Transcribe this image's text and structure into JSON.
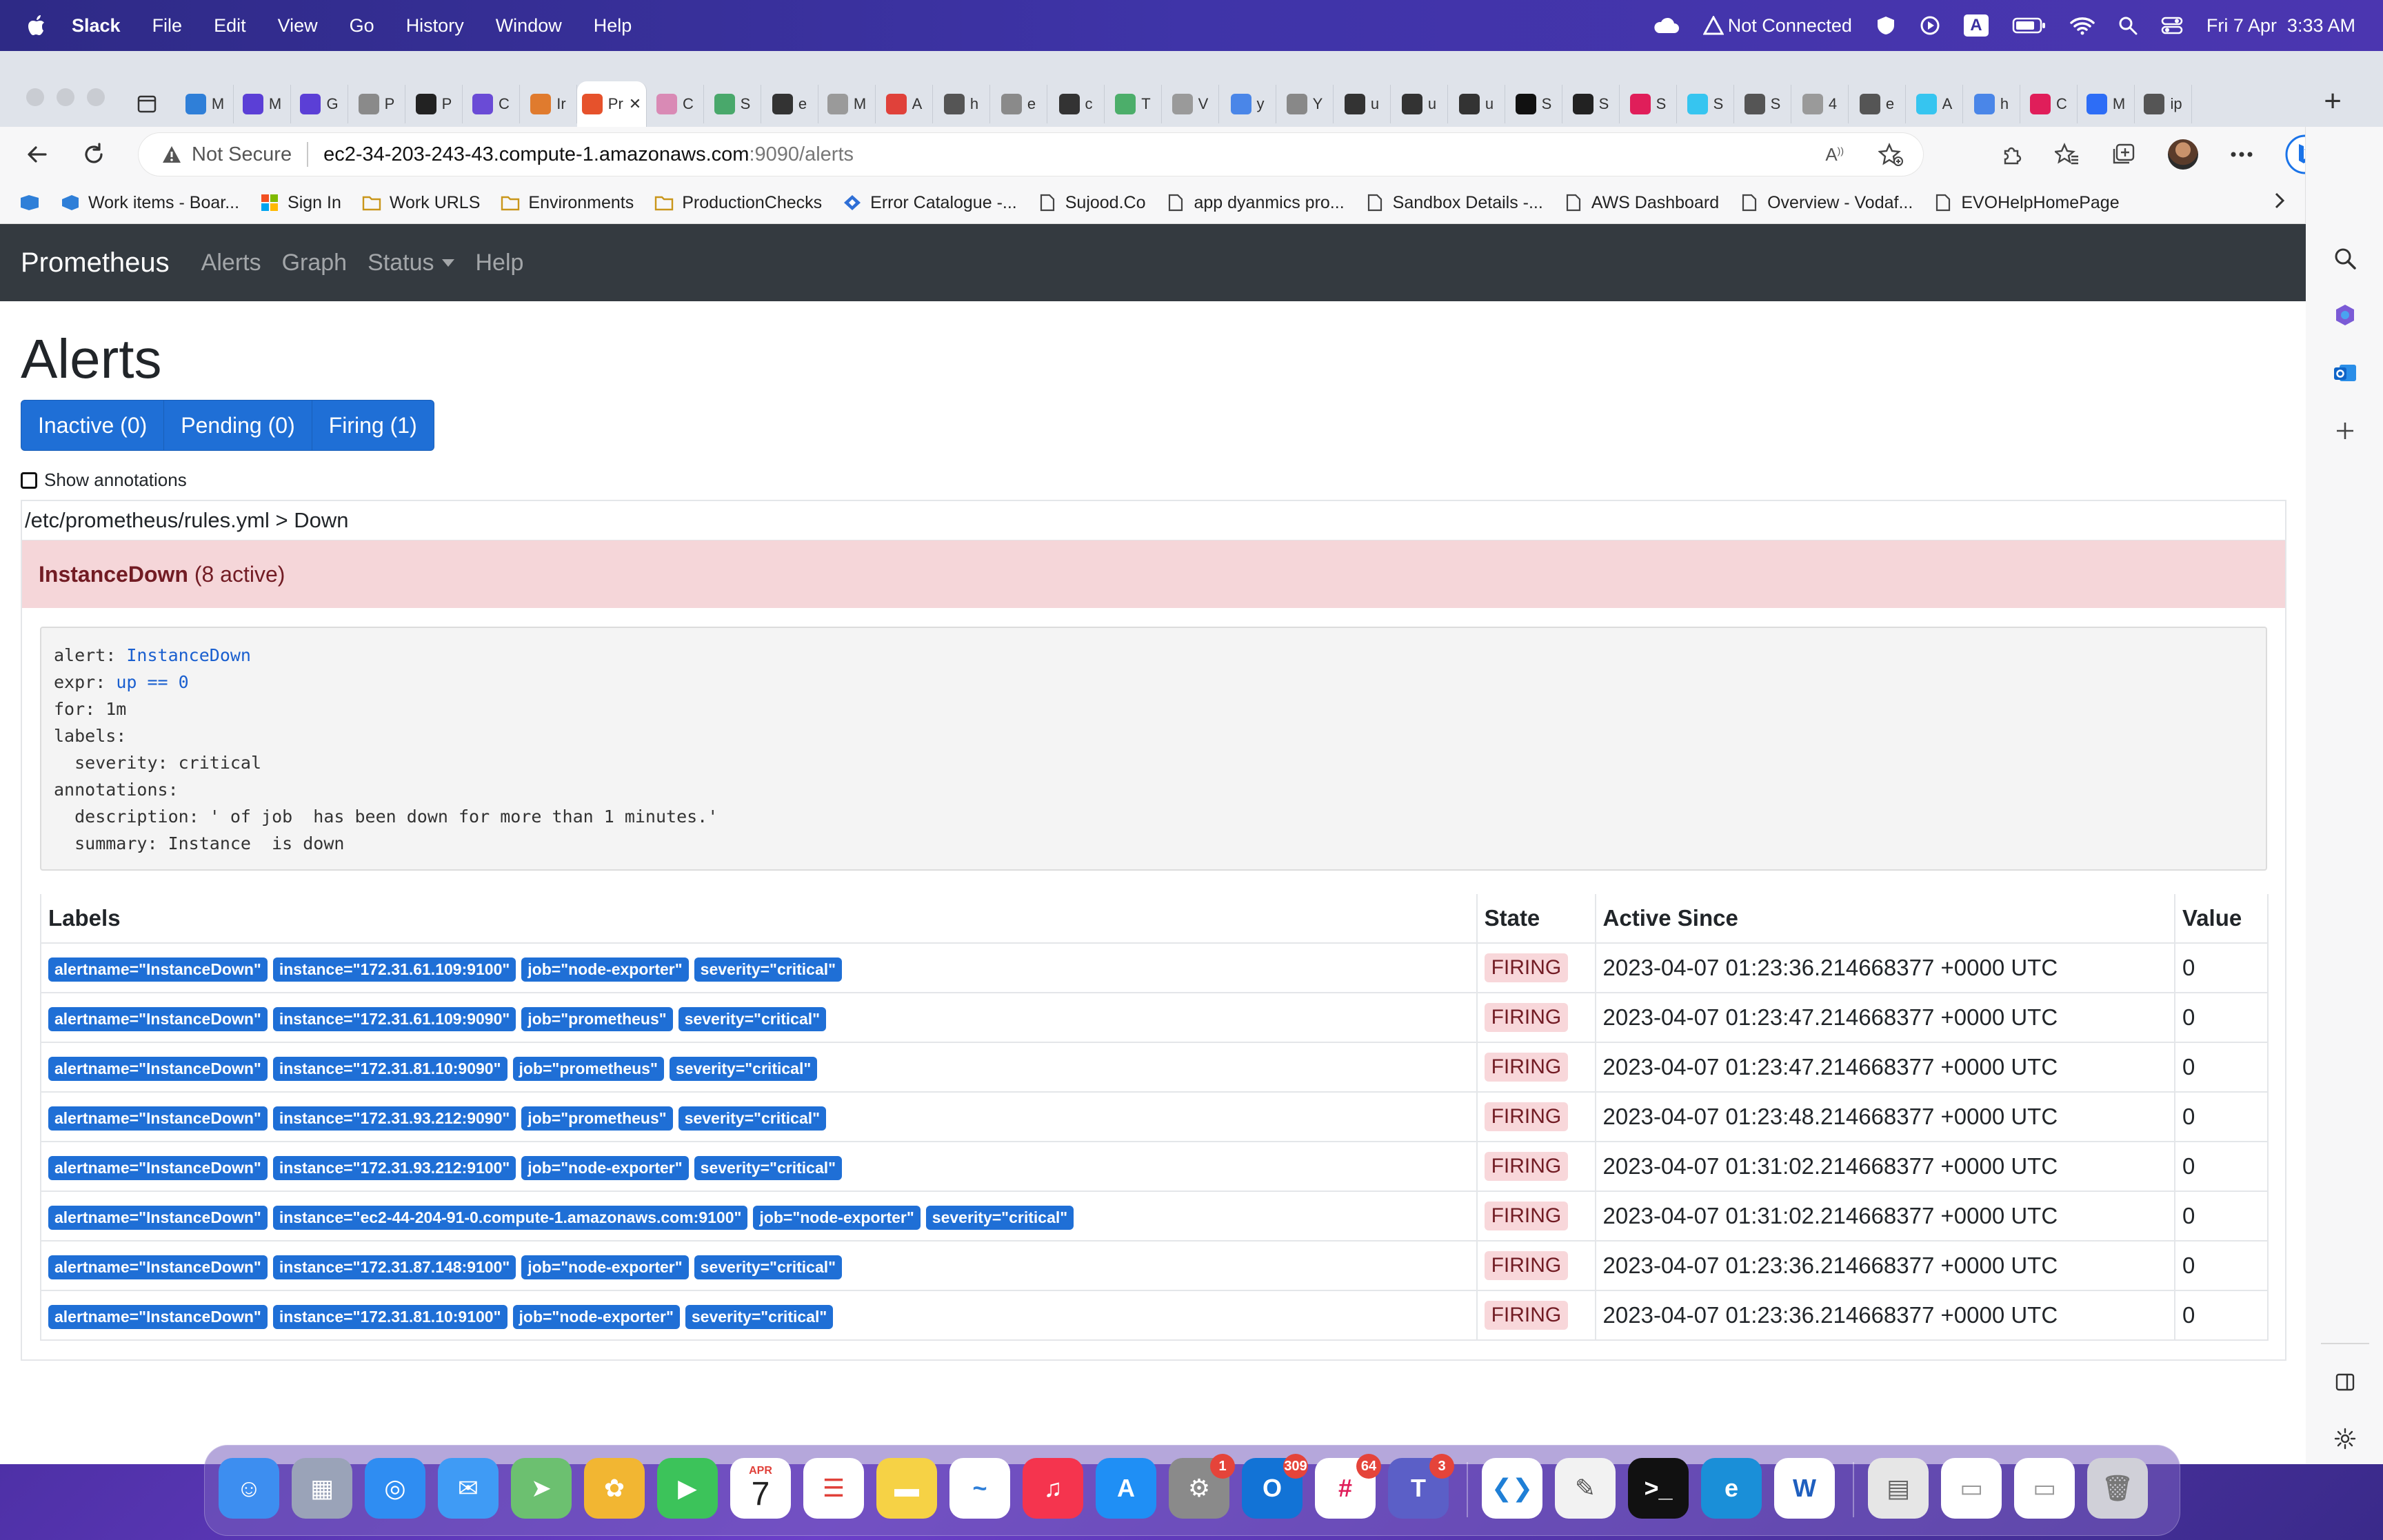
{
  "menubar": {
    "app": "Slack",
    "items": [
      "File",
      "Edit",
      "View",
      "Go",
      "History",
      "Window",
      "Help"
    ],
    "network_status": "Not Connected",
    "datetime": "Fri 7 Apr  3:33 AM",
    "input_source": "A"
  },
  "browser": {
    "tabs": [
      {
        "label": "M",
        "color": "#2f7fd8"
      },
      {
        "label": "M",
        "color": "#5b3fd6"
      },
      {
        "label": "G",
        "color": "#5b3fd6"
      },
      {
        "label": "P",
        "color": "#8a8a8a"
      },
      {
        "label": "P",
        "color": "#222222"
      },
      {
        "label": "C",
        "color": "#6a4bd6"
      },
      {
        "label": "Ir",
        "color": "#e07b2e"
      },
      {
        "label": "Pr",
        "color": "#e6522c",
        "active": true
      },
      {
        "label": "C",
        "color": "#d98ab5"
      },
      {
        "label": "S",
        "color": "#49a86b"
      },
      {
        "label": "e",
        "color": "#333333"
      },
      {
        "label": "M",
        "color": "#9a9a9a"
      },
      {
        "label": "A",
        "color": "#e0413a"
      },
      {
        "label": "h",
        "color": "#555555"
      },
      {
        "label": "e",
        "color": "#8a8a8a"
      },
      {
        "label": "c",
        "color": "#333333"
      },
      {
        "label": "T",
        "color": "#4cae6a"
      },
      {
        "label": "V",
        "color": "#9a9a9a"
      },
      {
        "label": "y",
        "color": "#4a86e8"
      },
      {
        "label": "Y",
        "color": "#888888"
      },
      {
        "label": "u",
        "color": "#333333"
      },
      {
        "label": "u",
        "color": "#333333"
      },
      {
        "label": "u",
        "color": "#333333"
      },
      {
        "label": "S",
        "color": "#111111"
      },
      {
        "label": "S",
        "color": "#222222"
      },
      {
        "label": "S",
        "color": "#e01e5a"
      },
      {
        "label": "S",
        "color": "#36c5f0"
      },
      {
        "label": "S",
        "color": "#555555"
      },
      {
        "label": "4",
        "color": "#9a9a9a"
      },
      {
        "label": "e",
        "color": "#555555"
      },
      {
        "label": "A",
        "color": "#36c5f0"
      },
      {
        "label": "h",
        "color": "#4a86e8"
      },
      {
        "label": "C",
        "color": "#e01e5a"
      },
      {
        "label": "M",
        "color": "#2d6df6"
      },
      {
        "label": "ip",
        "color": "#555555"
      }
    ],
    "new_tab_symbol": "+",
    "address": {
      "security_label": "Not Secure",
      "host": "ec2-34-203-243-43.compute-1.amazonaws.com",
      "path": ":9090/alerts"
    },
    "bookmarks": [
      "Work items - Boar...",
      "Sign In",
      "Work URLS",
      "Environments",
      "ProductionChecks",
      "Error Catalogue -...",
      "Sujood.Co",
      "app dyanmics pro...",
      "Sandbox Details -...",
      "AWS Dashboard",
      "Overview - Vodaf...",
      "EVOHelpHomePage"
    ]
  },
  "prometheus": {
    "brand": "Prometheus",
    "nav": [
      "Alerts",
      "Graph",
      "Status",
      "Help"
    ],
    "page_title": "Alerts",
    "filters": [
      "Inactive (0)",
      "Pending (0)",
      "Firing (1)"
    ],
    "show_annotations": "Show annotations",
    "group_header": "/etc/prometheus/rules.yml > Down",
    "rule_name": "InstanceDown",
    "rule_count": "(8 active)",
    "rule_def": {
      "l1_key": "alert: ",
      "l1_val": "InstanceDown",
      "l2_key": "expr: ",
      "l2_val": "up == 0",
      "l3": "for: 1m",
      "l4": "labels:",
      "l5": "  severity: critical",
      "l6": "annotations:",
      "l7": "  description: ' of job  has been down for more than 1 minutes.'",
      "l8": "  summary: Instance  is down"
    },
    "table_headers": [
      "Labels",
      "State",
      "Active Since",
      "Value"
    ],
    "rows": [
      {
        "labels": [
          "alertname=\"InstanceDown\"",
          "instance=\"172.31.61.109:9100\"",
          "job=\"node-exporter\"",
          "severity=\"critical\""
        ],
        "state": "FIRING",
        "since": "2023-04-07 01:23:36.214668377 +0000 UTC",
        "value": "0"
      },
      {
        "labels": [
          "alertname=\"InstanceDown\"",
          "instance=\"172.31.61.109:9090\"",
          "job=\"prometheus\"",
          "severity=\"critical\""
        ],
        "state": "FIRING",
        "since": "2023-04-07 01:23:47.214668377 +0000 UTC",
        "value": "0"
      },
      {
        "labels": [
          "alertname=\"InstanceDown\"",
          "instance=\"172.31.81.10:9090\"",
          "job=\"prometheus\"",
          "severity=\"critical\""
        ],
        "state": "FIRING",
        "since": "2023-04-07 01:23:47.214668377 +0000 UTC",
        "value": "0"
      },
      {
        "labels": [
          "alertname=\"InstanceDown\"",
          "instance=\"172.31.93.212:9090\"",
          "job=\"prometheus\"",
          "severity=\"critical\""
        ],
        "state": "FIRING",
        "since": "2023-04-07 01:23:48.214668377 +0000 UTC",
        "value": "0"
      },
      {
        "labels": [
          "alertname=\"InstanceDown\"",
          "instance=\"172.31.93.212:9100\"",
          "job=\"node-exporter\"",
          "severity=\"critical\""
        ],
        "state": "FIRING",
        "since": "2023-04-07 01:31:02.214668377 +0000 UTC",
        "value": "0"
      },
      {
        "labels": [
          "alertname=\"InstanceDown\"",
          "instance=\"ec2-44-204-91-0.compute-1.amazonaws.com:9100\"",
          "job=\"node-exporter\"",
          "severity=\"critical\""
        ],
        "state": "FIRING",
        "since": "2023-04-07 01:31:02.214668377 +0000 UTC",
        "value": "0"
      },
      {
        "labels": [
          "alertname=\"InstanceDown\"",
          "instance=\"172.31.87.148:9100\"",
          "job=\"node-exporter\"",
          "severity=\"critical\""
        ],
        "state": "FIRING",
        "since": "2023-04-07 01:23:36.214668377 +0000 UTC",
        "value": "0"
      },
      {
        "labels": [
          "alertname=\"InstanceDown\"",
          "instance=\"172.31.81.10:9100\"",
          "job=\"node-exporter\"",
          "severity=\"critical\""
        ],
        "state": "FIRING",
        "since": "2023-04-07 01:23:36.214668377 +0000 UTC",
        "value": "0"
      }
    ]
  },
  "dock": {
    "apps": [
      {
        "name": "finder-icon",
        "bg": "#3d8ef0",
        "glyph": "☺"
      },
      {
        "name": "launchpad-icon",
        "bg": "#9aa3b8",
        "glyph": "▦"
      },
      {
        "name": "safari-icon",
        "bg": "#2f8df2",
        "glyph": "◎"
      },
      {
        "name": "mail-icon",
        "bg": "#3f9bf5",
        "glyph": "✉"
      },
      {
        "name": "maps-icon",
        "bg": "#6cc070",
        "glyph": "➤"
      },
      {
        "name": "photos-icon",
        "bg": "#f2b632",
        "glyph": "✿"
      },
      {
        "name": "facetime-icon",
        "bg": "#3cc35a",
        "glyph": "▶"
      },
      {
        "name": "calendar-icon",
        "bg": "#ffffff",
        "glyph": "7",
        "fg": "#222222",
        "sub": "APR"
      },
      {
        "name": "reminders-icon",
        "bg": "#ffffff",
        "glyph": "☰",
        "fg": "#e0413a"
      },
      {
        "name": "notes-icon",
        "bg": "#f6d245",
        "glyph": "▬",
        "fg": "#ffffff"
      },
      {
        "name": "freeform-icon",
        "bg": "#ffffff",
        "glyph": "~",
        "fg": "#2f7fd8"
      },
      {
        "name": "music-icon",
        "bg": "#f5344e",
        "glyph": "♫"
      },
      {
        "name": "appstore-icon",
        "bg": "#1f8ff5",
        "glyph": "A"
      },
      {
        "name": "settings-icon",
        "bg": "#8a8a8a",
        "glyph": "⚙",
        "badge": "1"
      },
      {
        "name": "outlook-icon",
        "bg": "#1273d6",
        "glyph": "O",
        "badge": "309"
      },
      {
        "name": "slack-icon",
        "bg": "#ffffff",
        "glyph": "#",
        "fg": "#e01e5a",
        "badge": "64"
      },
      {
        "name": "teams-icon",
        "bg": "#5b5fc7",
        "glyph": "T",
        "badge": "3"
      },
      {
        "name": "vscode-icon",
        "bg": "#ffffff",
        "glyph": "❮❯",
        "fg": "#1f7fd6"
      },
      {
        "name": "textedit-icon",
        "bg": "#f2f2f2",
        "glyph": "✎",
        "fg": "#555555"
      },
      {
        "name": "terminal-icon",
        "bg": "#111111",
        "glyph": ">_"
      },
      {
        "name": "edge-icon",
        "bg": "#1a8fd8",
        "glyph": "e"
      },
      {
        "name": "word-icon",
        "bg": "#ffffff",
        "glyph": "W",
        "fg": "#1f5fbf"
      },
      {
        "name": "preview-icon",
        "bg": "#e6e6e6",
        "glyph": "▤",
        "fg": "#666666"
      },
      {
        "name": "window-thumb-icon",
        "bg": "#ffffff",
        "glyph": "▭",
        "fg": "#999999"
      },
      {
        "name": "window-thumb-2-icon",
        "bg": "#ffffff",
        "glyph": "▭",
        "fg": "#999999"
      },
      {
        "name": "trash-icon",
        "bg": "#d0d0d8",
        "glyph": "🗑",
        "fg": "#777777"
      }
    ]
  }
}
